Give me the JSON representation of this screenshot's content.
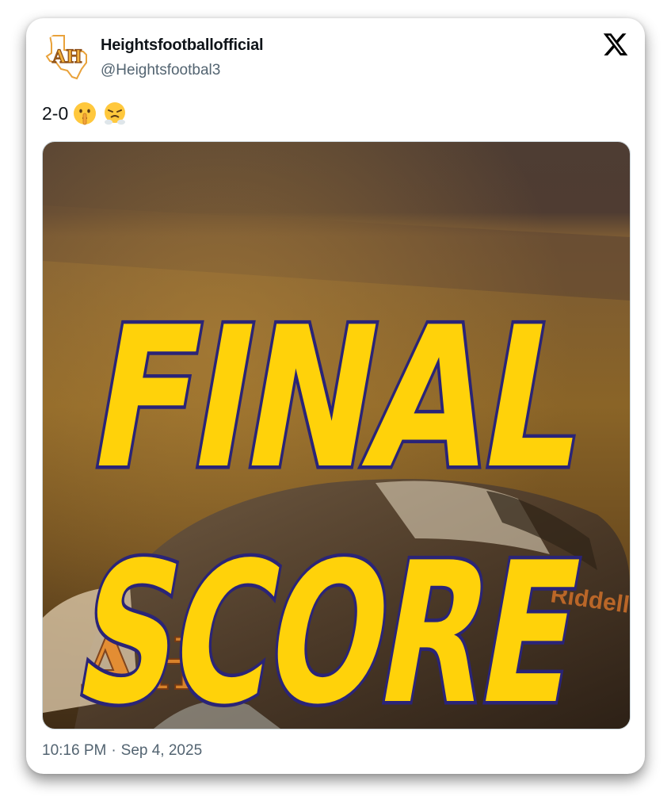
{
  "author": {
    "display_name": "Heightsfootballofficial",
    "handle": "@Heightsfootbal3",
    "avatar_icon": "texas-ah-logo-icon",
    "avatar_monogram": "AH"
  },
  "platform_icon": "x-logo-icon",
  "tweet": {
    "text": "2-0",
    "emojis": [
      "shushing-face-emoji",
      "steam-from-nose-emoji"
    ]
  },
  "media": {
    "line1": "FINAL",
    "line2": "SCORE",
    "helmet_logo": "AH",
    "helmet_brand": "Riddell",
    "colors": {
      "headline_fill": "#FFD20A",
      "headline_outline": "#2A2477",
      "background": "#6B4A1E"
    }
  },
  "meta": {
    "time": "10:16 PM",
    "separator": "·",
    "date": "Sep 4, 2025"
  }
}
